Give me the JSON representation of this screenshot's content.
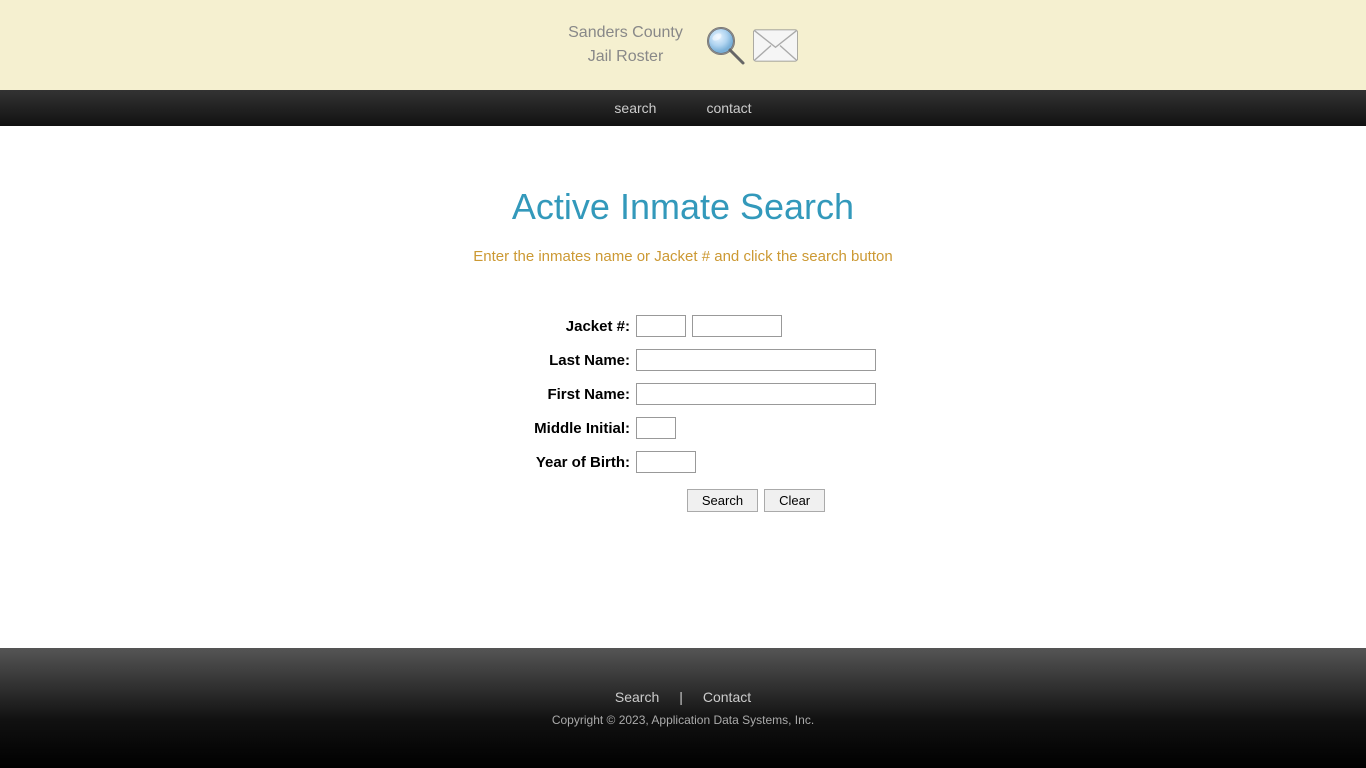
{
  "header": {
    "title_line1": "Sanders County",
    "title_line2": "Jail Roster"
  },
  "navbar": {
    "links": [
      {
        "label": "search",
        "id": "nav-search"
      },
      {
        "label": "contact",
        "id": "nav-contact"
      }
    ]
  },
  "main": {
    "page_title": "Active Inmate Search",
    "subtitle": "Enter the inmates name or Jacket # and click the search button",
    "form": {
      "jacket_label": "Jacket #:",
      "last_name_label": "Last Name:",
      "first_name_label": "First Name:",
      "middle_initial_label": "Middle Initial:",
      "year_of_birth_label": "Year of Birth:",
      "search_button": "Search",
      "clear_button": "Clear"
    }
  },
  "footer": {
    "link_search": "Search",
    "link_contact": "Contact",
    "copyright": "Copyright © 2023, Application Data Systems, Inc."
  }
}
